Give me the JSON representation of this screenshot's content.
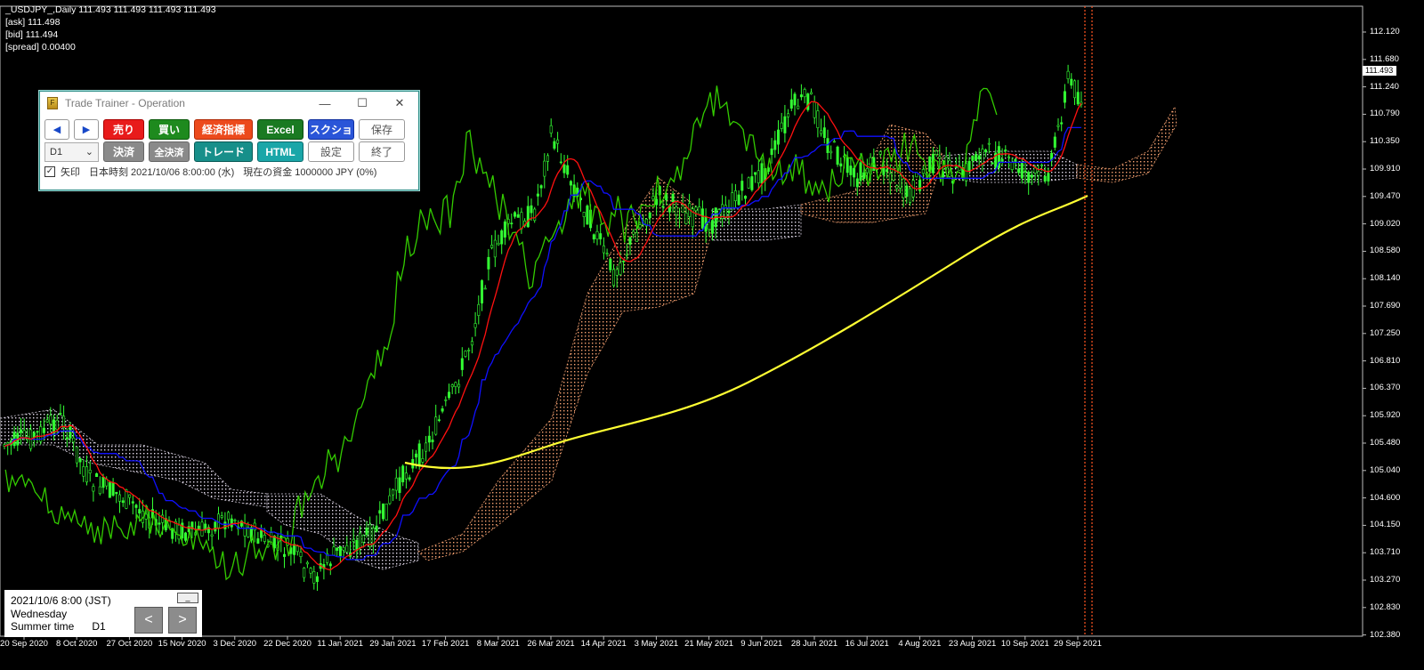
{
  "chart_header": {
    "symbol_line": "_USDJPY_,Daily  111.493 111.493 111.493 111.493",
    "ask_line": "[ask] 111.498",
    "bid_line": "[bid] 111.494",
    "spread_line": "[spread] 0.00400"
  },
  "trade_trainer": {
    "title": "Trade Trainer - Operation",
    "app_icon_glyph": "F",
    "win_min": "—",
    "win_max": "☐",
    "win_close": "✕",
    "row1": {
      "prev": "◀",
      "next": "▶",
      "sell": "売り",
      "buy": "買い",
      "economic": "経済指標",
      "excel": "Excel",
      "screenshot": "スクショ",
      "save": "保存"
    },
    "row2": {
      "timeframe_value": "D1",
      "timeframe_arrow": "⌄",
      "settle": "決済",
      "settle_all": "全決済",
      "trade": "トレード",
      "html": "HTML",
      "settings": "設定",
      "exit": "終了"
    },
    "status": {
      "checkbox_mark": "✓",
      "arrow_label": "矢印",
      "jp_time": "日本時刻 2021/10/06 8:00:00 (水)",
      "funds": "現在の資金 1000000 JPY (0%)"
    }
  },
  "bottom_panel": {
    "datetime": "2021/10/6 8:00 (JST)",
    "weekday": "Wednesday",
    "season": "Summer time",
    "timeframe": "D1",
    "minimize": "_",
    "prev": "<",
    "next": ">"
  },
  "price_axis": {
    "labels": [
      "112.120",
      "111.680",
      "111.240",
      "110.790",
      "110.350",
      "109.910",
      "109.470",
      "109.020",
      "108.580",
      "108.140",
      "107.690",
      "107.250",
      "106.810",
      "106.370",
      "105.920",
      "105.480",
      "105.040",
      "104.600",
      "104.150",
      "103.710",
      "103.270",
      "102.830",
      "102.380"
    ],
    "current_price": "111.493"
  },
  "time_axis": {
    "labels": [
      "20 Sep 2020",
      "8 Oct 2020",
      "27 Oct 2020",
      "15 Nov 2020",
      "3 Dec 2020",
      "22 Dec 2020",
      "11 Jan 2021",
      "29 Jan 2021",
      "17 Feb 2021",
      "8 Mar 2021",
      "26 Mar 2021",
      "14 Apr 2021",
      "3 May 2021",
      "21 May 2021",
      "9 Jun 2021",
      "28 Jun 2021",
      "16 Jul 2021",
      "4 Aug 2021",
      "23 Aug 2021",
      "10 Sep 2021",
      "29 Sep 2021"
    ]
  },
  "colors": {
    "background": "#000000",
    "candles": "#33ff33",
    "tenkan": "#ff0000",
    "kijun": "#0000ff",
    "chikou": "#33cc00",
    "ma": "#ffff33",
    "kumo_up": "#f4a070",
    "kumo_down": "#d8d0e0",
    "cursor_line": "#ff3300"
  }
}
